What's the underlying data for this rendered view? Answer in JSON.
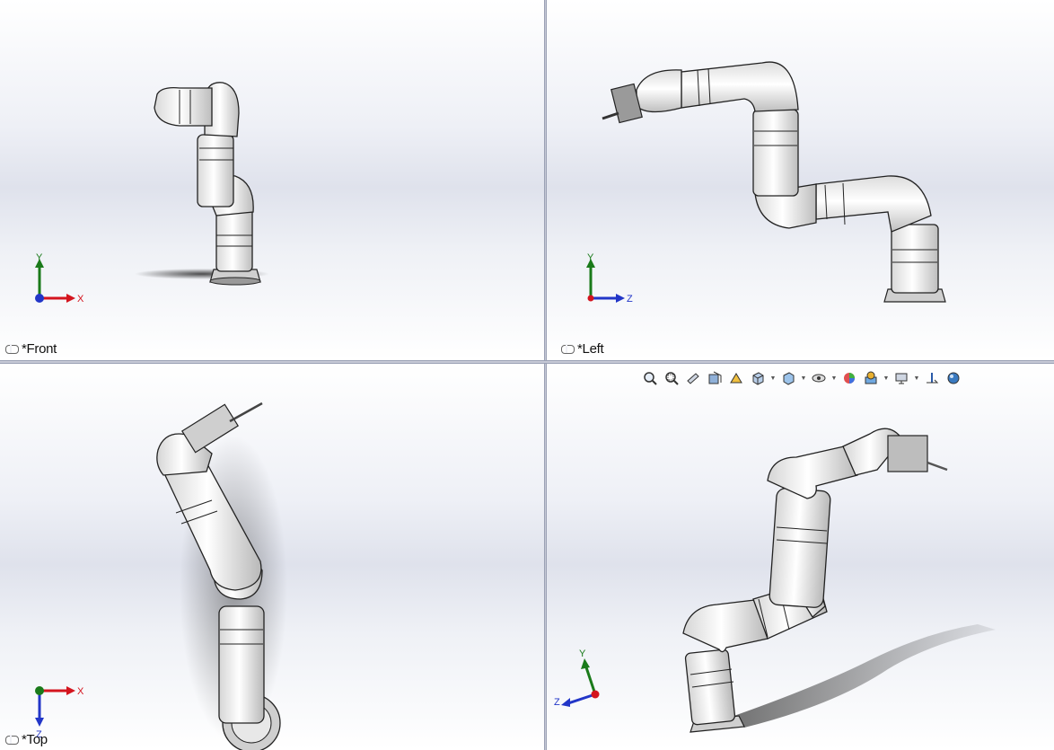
{
  "viewports": [
    {
      "label": "*Front",
      "axes": [
        "Y",
        "X"
      ]
    },
    {
      "label": "*Left",
      "axes": [
        "Y",
        "Z"
      ]
    },
    {
      "label": "*Top",
      "axes": [
        "X",
        "Z"
      ]
    },
    {
      "axes": [
        "Y",
        "Z"
      ]
    }
  ],
  "toolbar": {
    "icons": [
      "zoom-to-fit-icon",
      "zoom-to-area-icon",
      "previous-view-icon",
      "section-view-icon",
      "dynamic-annotation-icon",
      "view-orientation-icon",
      "display-style-icon",
      "hide-show-items-icon",
      "edit-appearance-icon",
      "apply-scene-icon",
      "view-settings-icon",
      "rotate-view-icon",
      "realview-icon"
    ]
  },
  "colors": {
    "axis_x": "#d4141e",
    "axis_y": "#1a7a1a",
    "axis_z": "#2236c8",
    "robot_body": "#ffffff",
    "robot_outline": "#1a1a1a"
  }
}
